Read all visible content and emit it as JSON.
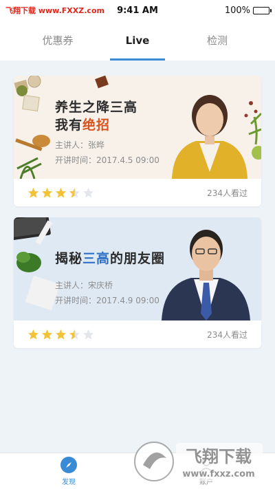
{
  "status_bar": {
    "carrier": "飞翔下载 www.FXXZ.com",
    "time": "9:41 AM",
    "battery": "100%"
  },
  "tabs": [
    {
      "label": "优惠券",
      "active": false
    },
    {
      "label": "Live",
      "active": true
    },
    {
      "label": "检测",
      "active": false
    }
  ],
  "cards": [
    {
      "title_line1": "养生之降三高",
      "title_line2_plain": "我有",
      "title_line2_highlight": "绝招",
      "lecturer": "主讲人：张晔",
      "time": "开讲时间：2017.4.5 09:00",
      "rating": 3.5,
      "views": "234人看过"
    },
    {
      "title_part1": "揭秘",
      "title_highlight": "三高",
      "title_part2": "的朋友圈",
      "lecturer": "主讲人：宋庆桥",
      "time": "开讲时间：2017.4.9 09:00",
      "rating": 3.5,
      "views": "234人看过"
    }
  ],
  "bottom_nav": [
    {
      "label": "发现",
      "icon": "compass-icon",
      "active": true
    },
    {
      "label": "账户",
      "icon": "user-icon",
      "active": false
    }
  ],
  "watermark": {
    "title": "飞翔下载",
    "url": "www.fxxz.com"
  },
  "colors": {
    "accent": "#3a8bd6",
    "star": "#f4c235",
    "highlight_red": "#d9531e",
    "highlight_blue": "#2d6fc4"
  }
}
